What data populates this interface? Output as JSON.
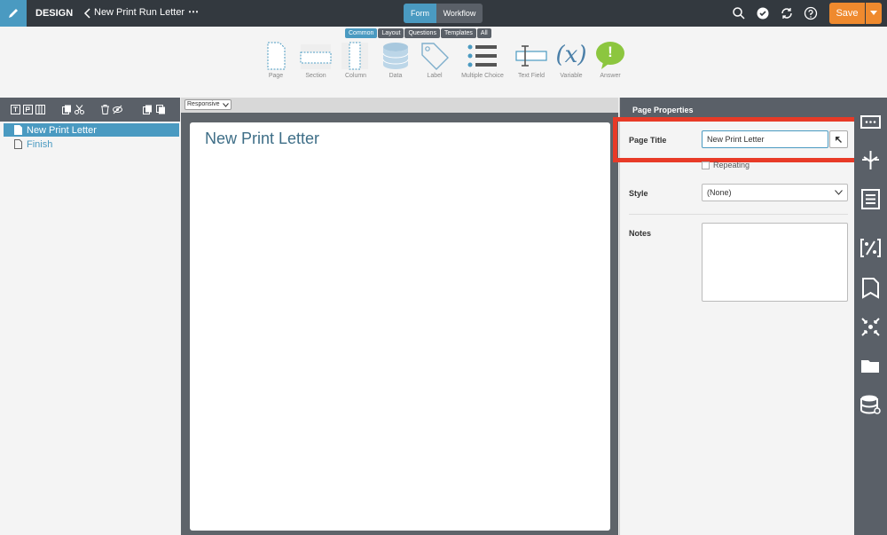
{
  "topbar": {
    "design_label": "DESIGN",
    "run_title": "New Print Run Letter",
    "more": "⋯",
    "modes": [
      "Form",
      "Workflow"
    ],
    "save_label": "Save"
  },
  "palette": {
    "tabs": [
      "Common",
      "Layout",
      "Questions",
      "Templates",
      "All"
    ],
    "items": [
      "Page",
      "Section",
      "Column",
      "Data",
      "Label",
      "Multiple Choice",
      "Text Field",
      "Variable",
      "Answer"
    ],
    "variable_glyph": "(x)",
    "answer_glyph": "!"
  },
  "tree": {
    "items": [
      {
        "label": "New Print Letter",
        "selected": true
      },
      {
        "label": "Finish",
        "selected": false
      }
    ]
  },
  "canvas": {
    "layout_mode": "Responsive",
    "page_heading": "New Print Letter"
  },
  "properties": {
    "header": "Page Properties",
    "page_title_label": "Page Title",
    "page_title_value": "New Print Letter",
    "repeating_label": "Repeating",
    "style_label": "Style",
    "style_value": "(None)",
    "notes_label": "Notes"
  },
  "colors": {
    "accent": "#4a9ac1",
    "save": "#ef8a2e",
    "highlight": "#e83a27",
    "dark": "#33393f"
  }
}
